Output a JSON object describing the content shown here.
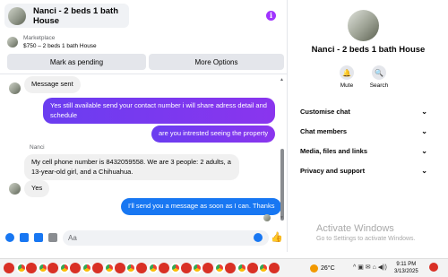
{
  "chat": {
    "title": "Nanci - 2 beds 1 bath House",
    "listing_category": "Marketplace",
    "listing_summary": "$750 – 2 beds 1 bath House",
    "mark_pending_label": "Mark as pending",
    "more_options_label": "More Options",
    "composer_placeholder": "Aa",
    "messages": [
      {
        "direction": "in",
        "text": "Message sent"
      },
      {
        "direction": "out",
        "text": "Yes still available send your contact number i will share adress detail and schedule"
      },
      {
        "direction": "out",
        "text": "are you intrested seeing the property"
      },
      {
        "sender": "Nanci"
      },
      {
        "direction": "in",
        "text": "My cell phone number is 8432059558. We are 3 people: 2 adults, a 13-year-old girl, and a Chihuahua."
      },
      {
        "direction": "in",
        "text": "Yes"
      },
      {
        "direction": "out",
        "text": "I'll send you a message as soon as I can. Thanks"
      }
    ]
  },
  "side": {
    "name": "Nanci - 2 beds 1 bath House",
    "mute_label": "Mute",
    "search_label": "Search",
    "sections": [
      "Customise chat",
      "Chat members",
      "Media, files and links",
      "Privacy and support"
    ]
  },
  "watermark": {
    "line1": "Activate Windows",
    "line2": "Go to Settings to activate Windows."
  },
  "taskbar": {
    "temperature": "26°C",
    "time": "9:11 PM",
    "date": "3/13/2025"
  },
  "colors": {
    "accent_purple": "#7c3aed",
    "accent_blue": "#1877f2",
    "info_purple": "#a033ff"
  }
}
